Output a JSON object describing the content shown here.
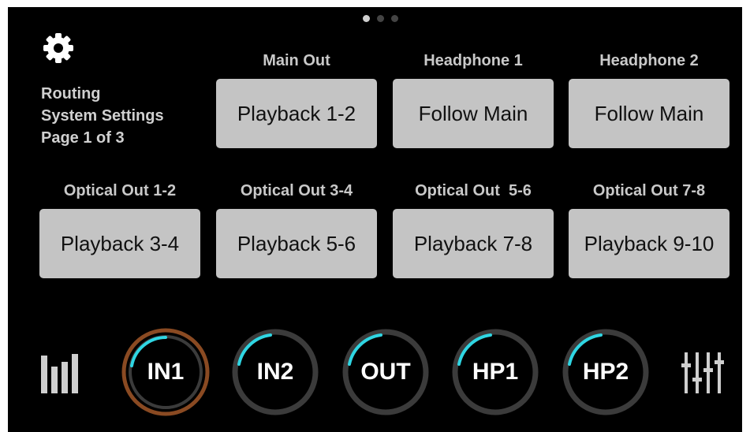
{
  "header": {
    "page_count": 3,
    "active_page": 1
  },
  "info": {
    "title": "Routing",
    "subtitle": "System Settings",
    "page": "Page 1 of 3"
  },
  "routes_row1": [
    {
      "label": "Main Out",
      "value": "Playback 1-2"
    },
    {
      "label": "Headphone 1",
      "value": "Follow Main"
    },
    {
      "label": "Headphone 2",
      "value": "Follow Main"
    }
  ],
  "routes_row2": [
    {
      "label": "Optical Out 1-2",
      "value": "Playback 3-4"
    },
    {
      "label": "Optical Out 3-4",
      "value": "Playback 5-6"
    },
    {
      "label": "Optical Out  5-6",
      "value": "Playback 7-8"
    },
    {
      "label": "Optical Out 7-8",
      "value": "Playback 9-10"
    }
  ],
  "knobs": [
    {
      "label": "IN1",
      "selected": true
    },
    {
      "label": "IN2",
      "selected": false
    },
    {
      "label": "OUT",
      "selected": false
    },
    {
      "label": "HP1",
      "selected": false
    },
    {
      "label": "HP2",
      "selected": false
    }
  ],
  "icons": {
    "settings": "gear-icon",
    "meters": "level-meter-icon",
    "mixer": "mixer-faders-icon"
  },
  "colors": {
    "background": "#000000",
    "button": "#c4c4c4",
    "accent": "#2fd6e3",
    "selected_ring": "#8a4a22",
    "ring": "#3b3b3b"
  }
}
